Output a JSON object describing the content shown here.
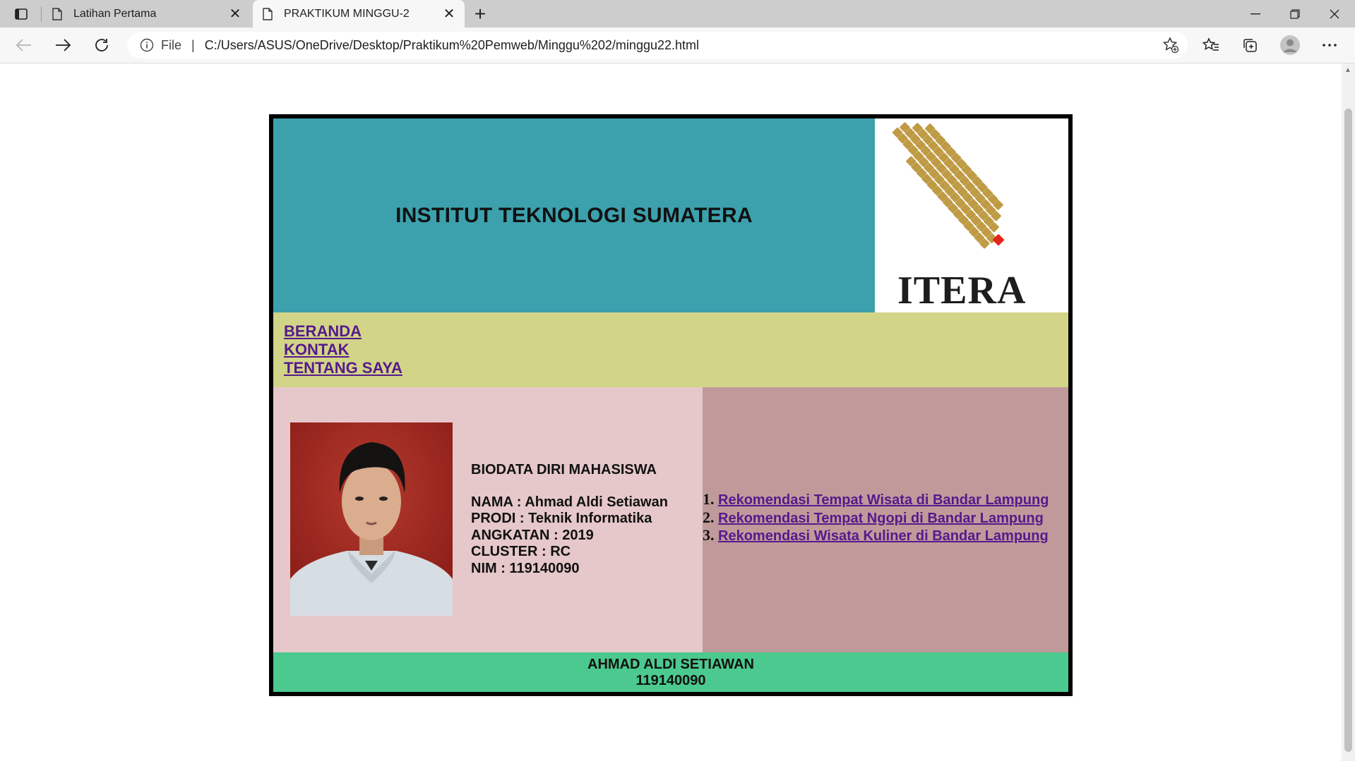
{
  "browser": {
    "tabs": [
      {
        "title": "Latihan Pertama",
        "active": false
      },
      {
        "title": "PRAKTIKUM MINGGU-2",
        "active": true
      }
    ],
    "address": {
      "scheme_label": "File",
      "url": "C:/Users/ASUS/OneDrive/Desktop/Praktikum%20Pemweb/Minggu%202/minggu22.html"
    }
  },
  "page": {
    "header_title": "INSTITUT TEKNOLOGI SUMATERA",
    "logo_text": "ITERA",
    "nav": [
      "BERANDA",
      "KONTAK",
      "TENTANG SAYA"
    ],
    "bio": {
      "title": "BIODATA DIRI MAHASISWA",
      "lines": [
        "NAMA : Ahmad Aldi Setiawan",
        "PRODI : Teknik Informatika",
        "ANGKATAN : 2019",
        "CLUSTER : RC",
        "NIM : 119140090"
      ]
    },
    "links": [
      "Rekomendasi Tempat Wisata di Bandar Lampung",
      "Rekomendasi Tempat Ngopi di Bandar Lampung",
      "Rekomendasi Wisata Kuliner di Bandar Lampung"
    ],
    "footer": {
      "name": "AHMAD ALDI SETIAWAN",
      "nim": "119140090"
    }
  },
  "colors": {
    "header_bg": "#3ca1ad",
    "nav_bg": "#d2d488",
    "bio_bg": "#e6c8ca",
    "links_bg": "#c09a9b",
    "footer_bg": "#4bc98f",
    "logo_gold": "#bf9b45",
    "logo_red": "#e1251b",
    "link_color": "#551a8b"
  },
  "icons": [
    "tab-actions-icon",
    "page-icon",
    "close-icon",
    "new-tab-icon",
    "minimize-icon",
    "restore-icon",
    "window-close-icon",
    "back-icon",
    "forward-icon",
    "refresh-icon",
    "info-icon",
    "add-favorite-icon",
    "favorites-icon",
    "collections-icon",
    "profile-icon",
    "more-icon"
  ]
}
